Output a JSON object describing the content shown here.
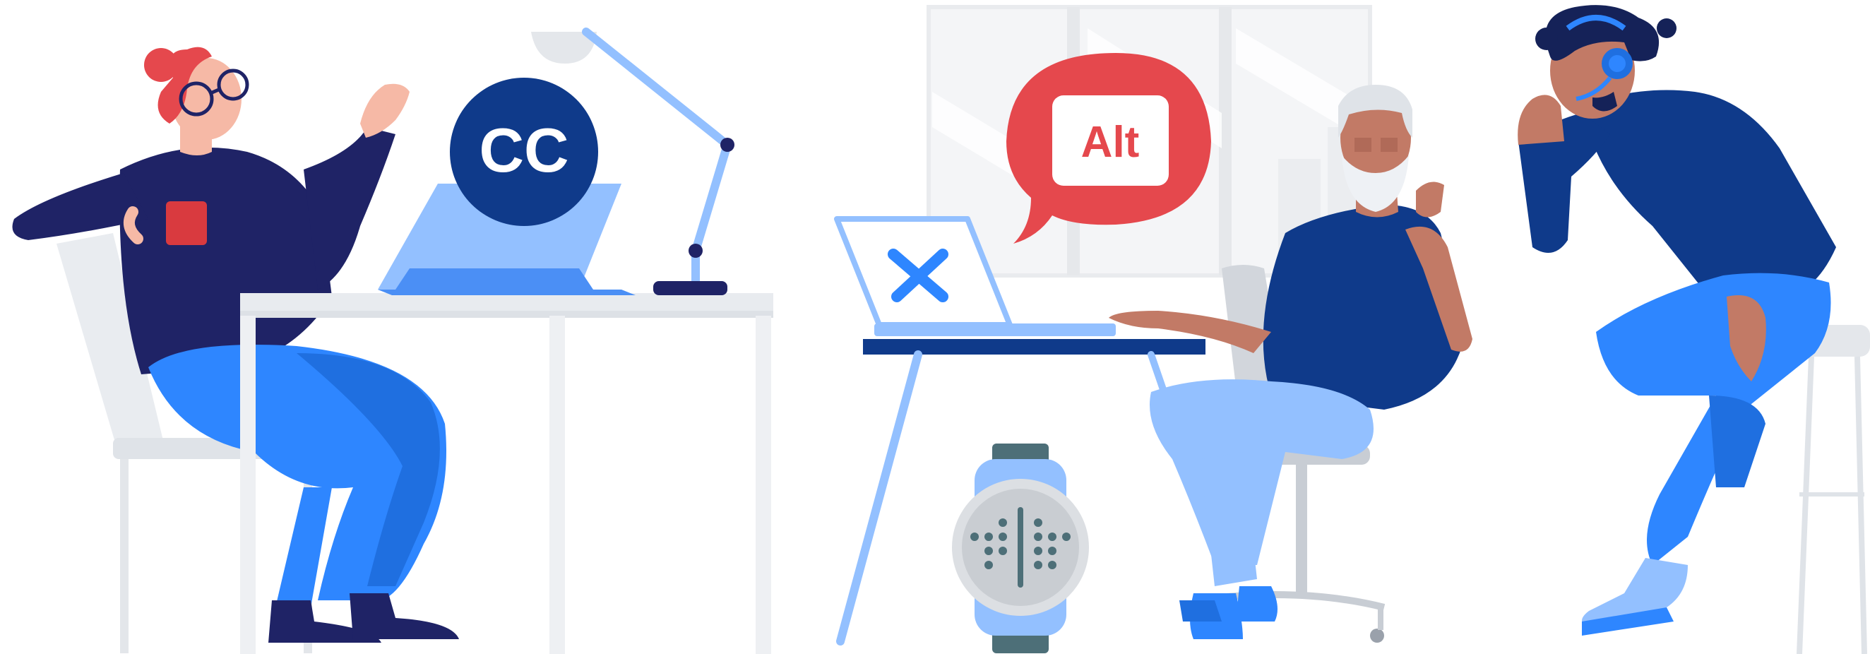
{
  "caption_badge": {
    "label": "CC",
    "icon": "closed-captions-icon"
  },
  "alt_text_bubble": {
    "label": "Alt",
    "icon": "alt-text-speech-bubble-icon"
  },
  "laptop_screen": {
    "icon": "close-x-icon"
  },
  "braille_watch": {
    "icon": "braille-watch-icon"
  },
  "headset": {
    "icon": "headset-icon"
  },
  "colors": {
    "navy": "#1e2a6e",
    "dark_blue": "#0f3a8a",
    "brand_blue": "#2e86ff",
    "light_blue": "#93c0ff",
    "red": "#e5484d",
    "skin_light": "#f6b9a6",
    "skin_dark": "#c27a66",
    "gray_light": "#eceff3"
  }
}
